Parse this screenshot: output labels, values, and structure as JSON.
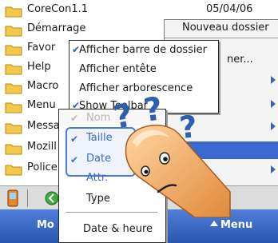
{
  "files": [
    {
      "name": "CoreCon1.1",
      "date": "05/04/06"
    },
    {
      "name": "Démarrage",
      "date": ""
    },
    {
      "name": "Favor",
      "date": ""
    },
    {
      "name": "Help",
      "date": ""
    },
    {
      "name": "Macro",
      "date": ""
    },
    {
      "name": "Menu",
      "date": ""
    },
    {
      "name": "Messa",
      "date": ""
    },
    {
      "name": "Mozill",
      "date": ""
    },
    {
      "name": "Police",
      "date": ""
    }
  ],
  "right_menu": {
    "new_folder": "Nouveau dossier",
    "partial_item": "ner..."
  },
  "view_menu": {
    "items": [
      {
        "label": "Afficher barre de dossier",
        "checked": true
      },
      {
        "label": "Afficher entête",
        "checked": false
      },
      {
        "label": "Afficher arborescence",
        "checked": false
      },
      {
        "label": "Show Toolbar",
        "checked": true
      }
    ]
  },
  "sort_menu": {
    "items": [
      {
        "label": "Nom",
        "checked": true,
        "faded": true
      },
      {
        "label": "Taille",
        "checked": true,
        "faded": false
      },
      {
        "label": "Date",
        "checked": true,
        "faded": false
      },
      {
        "label": "Attr.",
        "checked": false,
        "faded": false
      },
      {
        "label": "Type",
        "checked": false,
        "faded": false
      },
      {
        "label": "Date & heure",
        "checked": false,
        "faded": false
      }
    ]
  },
  "softkeys": {
    "left": "Mo",
    "right": "Menu"
  },
  "colors": {
    "folder": "#f2c94c",
    "highlight": "#3a6ad0",
    "softkey_bar": "#2a55b0",
    "question_marks": "#2f5fb0",
    "finger": "#f2a74e"
  }
}
